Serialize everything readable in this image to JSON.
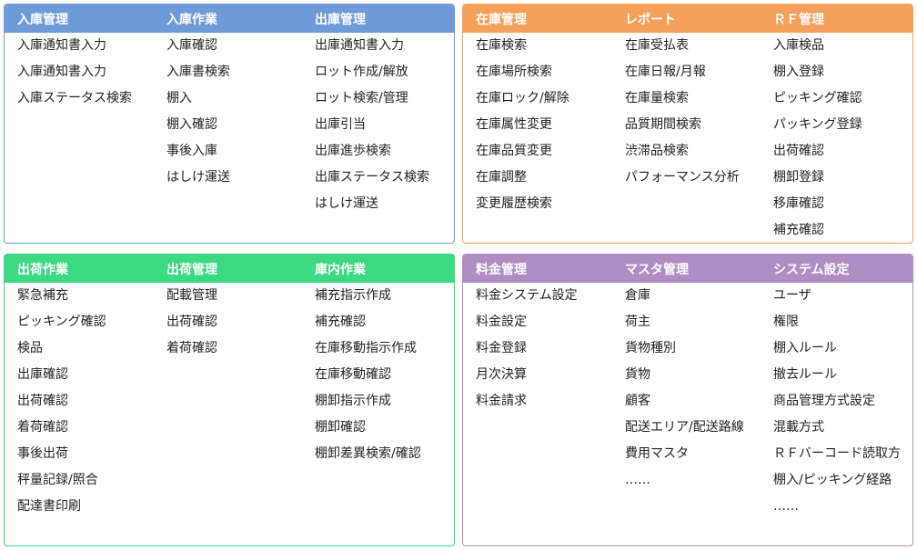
{
  "panels": [
    {
      "id": "inbound",
      "color": "#6e9ad8",
      "columns": [
        {
          "title": "入庫管理",
          "items": [
            "入庫通知書入力",
            "入庫通知書入力",
            "入庫ステータス検索"
          ]
        },
        {
          "title": "入庫作業",
          "items": [
            "入庫確認",
            "入庫書検索",
            "棚入",
            "棚入確認",
            "事後入庫",
            "はしけ運送"
          ]
        },
        {
          "title": "出庫管理",
          "items": [
            "出庫通知書入力",
            "ロット作成/解放",
            "ロット検索/管理",
            "出庫引当",
            "出庫進歩検索",
            "出庫ステータス検索",
            "はしけ運送"
          ]
        }
      ]
    },
    {
      "id": "inventory",
      "color": "#f5a05a",
      "columns": [
        {
          "title": "在庫管理",
          "items": [
            "在庫検索",
            "在庫場所検索",
            "在庫ロック/解除",
            "在庫属性変更",
            "在庫品質変更",
            "在庫調整",
            "変更履歴検索"
          ]
        },
        {
          "title": "レポート",
          "items": [
            "在庫受払表",
            "在庫日報/月報",
            "在庫量検索",
            "品質期間検索",
            "渋滞品検索",
            "パフォーマンス分析"
          ]
        },
        {
          "title": "ＲＦ管理",
          "items": [
            "入庫検品",
            "棚入登録",
            "ピッキング確認",
            "パッキング登録",
            "出荷確認",
            "棚卸登録",
            "移庫確認",
            "補充確認"
          ]
        }
      ]
    },
    {
      "id": "shipping",
      "color": "#3cd882",
      "columns": [
        {
          "title": "出荷作業",
          "items": [
            "緊急補充",
            "ピッキング確認",
            "検品",
            "出庫確認",
            "出荷確認",
            "着荷確認",
            "事後出荷",
            "秤量記録/照合",
            "配達書印刷"
          ]
        },
        {
          "title": "出荷管理",
          "items": [
            "配載管理",
            "出荷確認",
            "着荷確認"
          ]
        },
        {
          "title": "庫内作業",
          "items": [
            "補充指示作成",
            "補充確認",
            "在庫移動指示作成",
            "在庫移動確認",
            "棚卸指示作成",
            "棚卸確認",
            "棚卸差異検索/確認"
          ]
        }
      ]
    },
    {
      "id": "billing",
      "color": "#b08cc4",
      "columns": [
        {
          "title": "料金管理",
          "items": [
            "料金システム設定",
            "料金設定",
            "料金登録",
            "月次決算",
            "料金請求"
          ]
        },
        {
          "title": "マスタ管理",
          "items": [
            "倉庫",
            "荷主",
            "貨物種別",
            "貨物",
            "顧客",
            "配送エリア/配送路線",
            "費用マスタ",
            "……"
          ]
        },
        {
          "title": "システム設定",
          "items": [
            "ユーザ",
            "権限",
            "棚入ルール",
            "撤去ルール",
            "商品管理方式設定",
            "混載方式",
            "ＲＦバーコード読取方",
            "棚入/ピッキング経路",
            "……"
          ]
        }
      ]
    }
  ]
}
